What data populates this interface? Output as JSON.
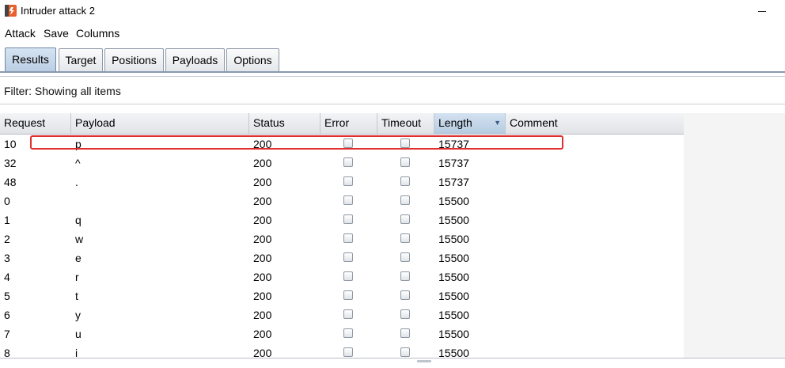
{
  "window": {
    "title": "Intruder attack 2"
  },
  "menu": {
    "items": [
      "Attack",
      "Save",
      "Columns"
    ]
  },
  "tabs": {
    "items": [
      "Results",
      "Target",
      "Positions",
      "Payloads",
      "Options"
    ],
    "active": "Results"
  },
  "filter": {
    "text": "Filter: Showing all items"
  },
  "table": {
    "columns": [
      "Request",
      "Payload",
      "Status",
      "Error",
      "Timeout",
      "Length",
      "Comment"
    ],
    "sorted_column": "Length",
    "sort_direction": "descending",
    "rows": [
      {
        "request": "10",
        "payload": "p",
        "status": "200",
        "error": false,
        "timeout": false,
        "length": "15737",
        "comment": ""
      },
      {
        "request": "32",
        "payload": "^",
        "status": "200",
        "error": false,
        "timeout": false,
        "length": "15737",
        "comment": ""
      },
      {
        "request": "48",
        "payload": ".",
        "status": "200",
        "error": false,
        "timeout": false,
        "length": "15737",
        "comment": ""
      },
      {
        "request": "0",
        "payload": "",
        "status": "200",
        "error": false,
        "timeout": false,
        "length": "15500",
        "comment": ""
      },
      {
        "request": "1",
        "payload": "q",
        "status": "200",
        "error": false,
        "timeout": false,
        "length": "15500",
        "comment": ""
      },
      {
        "request": "2",
        "payload": "w",
        "status": "200",
        "error": false,
        "timeout": false,
        "length": "15500",
        "comment": ""
      },
      {
        "request": "3",
        "payload": "e",
        "status": "200",
        "error": false,
        "timeout": false,
        "length": "15500",
        "comment": ""
      },
      {
        "request": "4",
        "payload": "r",
        "status": "200",
        "error": false,
        "timeout": false,
        "length": "15500",
        "comment": ""
      },
      {
        "request": "5",
        "payload": "t",
        "status": "200",
        "error": false,
        "timeout": false,
        "length": "15500",
        "comment": ""
      },
      {
        "request": "6",
        "payload": "y",
        "status": "200",
        "error": false,
        "timeout": false,
        "length": "15500",
        "comment": ""
      },
      {
        "request": "7",
        "payload": "u",
        "status": "200",
        "error": false,
        "timeout": false,
        "length": "15500",
        "comment": ""
      },
      {
        "request": "8",
        "payload": "i",
        "status": "200",
        "error": false,
        "timeout": false,
        "length": "15500",
        "comment": ""
      }
    ]
  },
  "colors": {
    "highlight": "#e0302e",
    "sorted_header": "#b6cbe1",
    "app_icon": "#e8612c"
  }
}
